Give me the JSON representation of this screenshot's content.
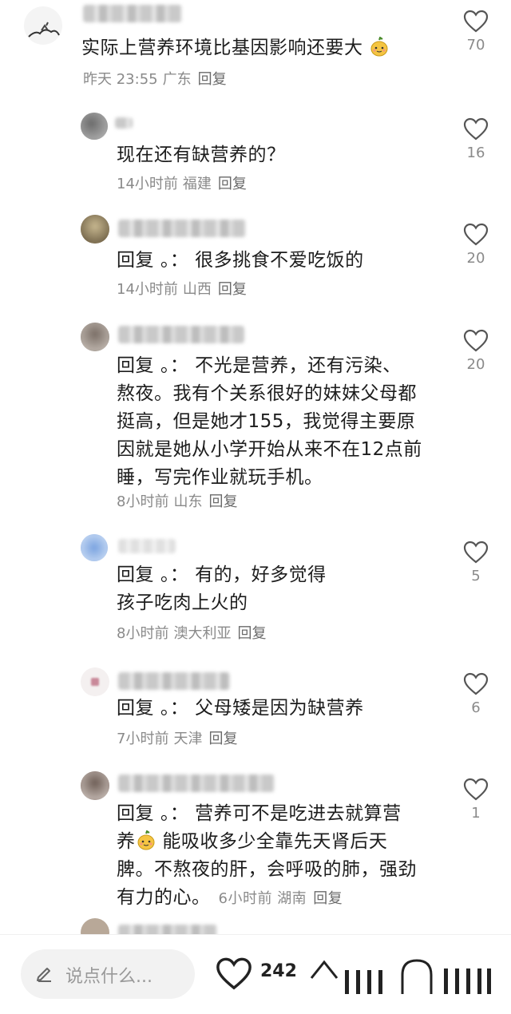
{
  "comments": [
    {
      "text": "实际上营养环境比基因影响还要大",
      "time": "昨天 23:55",
      "location": "广东",
      "reply": "回复",
      "likes": "70"
    },
    {
      "text": "现在还有缺营养的？",
      "time": "14小时前",
      "location": "福建",
      "reply": "回复",
      "likes": "16"
    },
    {
      "prefix": "回复",
      "sep": "。：",
      "text": "很多挑食不爱吃饭的",
      "time": "14小时前",
      "location": "山西",
      "reply": "回复",
      "likes": "20"
    },
    {
      "prefix": "回复",
      "sep": "。：",
      "line1": "不光是营养，还有污染、",
      "line2": "熬夜。我有个关系很好的妹妹父母都",
      "line3": "挺高，但是她才155，我觉得主要原",
      "line4": "因就是她从小学开始从来不在12点前",
      "line5": "睡，写完作业就玩手机。",
      "time": "8小时前",
      "location": "山东",
      "reply": "回复",
      "likes": "20"
    },
    {
      "prefix": "回复",
      "sep": "。：",
      "line1": "有的，好多觉得",
      "line2": "孩子吃肉上火的",
      "time": "8小时前",
      "location": "澳大利亚",
      "reply": "回复",
      "likes": "5"
    },
    {
      "prefix": "回复",
      "sep": "。：",
      "text": "父母矮是因为缺营养",
      "time": "7小时前",
      "location": "天津",
      "reply": "回复",
      "likes": "6"
    },
    {
      "prefix": "回复",
      "sep": "。：",
      "line1": "营养可不是吃进去就算营",
      "line2a": "养",
      "line2b": "能吸收多少全靠先天肾后天",
      "line3": "脾。不熬夜的肝，会呼吸的肺，强劲",
      "line4": "有力的心。",
      "time": "6小时前",
      "location": "湖南",
      "reply": "回复",
      "likes": "1"
    }
  ],
  "bottom": {
    "placeholder": "说点什么...",
    "like_count": "242"
  },
  "colors": {
    "meta": "#8a8a8a",
    "text": "#1d1d1d",
    "icon": "#555555"
  }
}
